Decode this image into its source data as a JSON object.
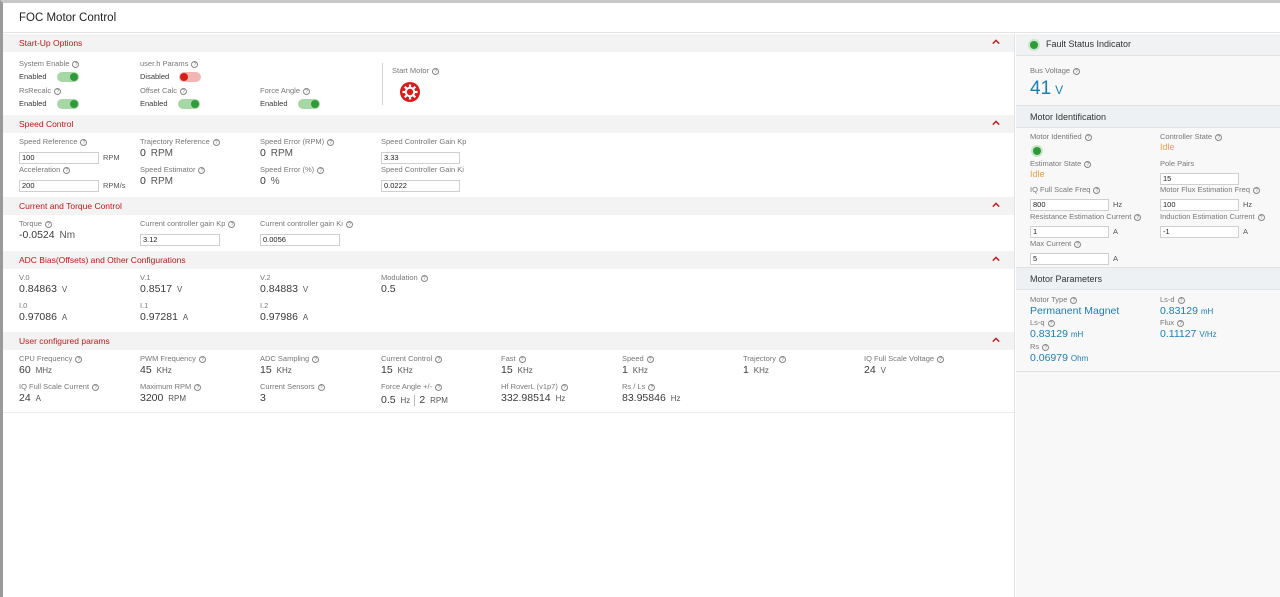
{
  "app": {
    "title": "FOC Motor Control"
  },
  "startup": {
    "title": "Start-Up Options",
    "system_enable": {
      "label": "System Enable",
      "state": "Enabled"
    },
    "userh_params": {
      "label": "user.h Params",
      "state": "Disabled"
    },
    "rsrecalc": {
      "label": "RsRecalc",
      "state": "Enabled"
    },
    "offset_calc": {
      "label": "Offset Calc",
      "state": "Enabled"
    },
    "force_angle": {
      "label": "Force Angle",
      "state": "Enabled"
    },
    "start_motor": {
      "label": "Start Motor"
    }
  },
  "speed": {
    "title": "Speed Control",
    "speed_reference": {
      "label": "Speed Reference",
      "value": "100",
      "unit": "RPM"
    },
    "trajectory_reference": {
      "label": "Trajectory Reference",
      "value": "0",
      "unit": "RPM"
    },
    "speed_error_rpm": {
      "label": "Speed Error (RPM)",
      "value": "0",
      "unit": "RPM"
    },
    "kp": {
      "label": "Speed Controller Gain Kp",
      "value": "3.33"
    },
    "acceleration": {
      "label": "Acceleration",
      "value": "200",
      "unit": "RPM/s"
    },
    "speed_estimator": {
      "label": "Speed Estimator",
      "value": "0",
      "unit": "RPM"
    },
    "speed_error_pct": {
      "label": "Speed Error (%)",
      "value": "0",
      "unit": "%"
    },
    "ki": {
      "label": "Speed Controller Gain Ki",
      "value": "0.0222"
    }
  },
  "current": {
    "title": "Current and Torque Control",
    "torque": {
      "label": "Torque",
      "value": "-0.0524",
      "unit": "Nm"
    },
    "kp": {
      "label": "Current controller gain Kp",
      "value": "3.12"
    },
    "ki": {
      "label": "Current controller gain Ki",
      "value": "0.0056"
    }
  },
  "adc": {
    "title": "ADC Bias(Offsets) and Other Configurations",
    "v0": {
      "label": "V.0",
      "value": "0.84863",
      "unit": "V"
    },
    "v1": {
      "label": "V.1",
      "value": "0.8517",
      "unit": "V"
    },
    "v2": {
      "label": "V.2",
      "value": "0.84883",
      "unit": "V"
    },
    "modulation": {
      "label": "Modulation",
      "value": "0.5"
    },
    "i0": {
      "label": "I.0",
      "value": "0.97086",
      "unit": "A"
    },
    "i1": {
      "label": "I.1",
      "value": "0.97281",
      "unit": "A"
    },
    "i2": {
      "label": "I.2",
      "value": "0.97986",
      "unit": "A"
    }
  },
  "user": {
    "title": "User configured params",
    "cpu": {
      "label": "CPU Frequency",
      "value": "60",
      "unit": "MHz"
    },
    "pwm": {
      "label": "PWM Frequency",
      "value": "45",
      "unit": "KHz"
    },
    "adc": {
      "label": "ADC Sampling",
      "value": "15",
      "unit": "KHz"
    },
    "cc": {
      "label": "Current Control",
      "value": "15",
      "unit": "KHz"
    },
    "fast": {
      "label": "Fast",
      "value": "15",
      "unit": "KHz"
    },
    "speed": {
      "label": "Speed",
      "value": "1",
      "unit": "KHz"
    },
    "traj": {
      "label": "Trajectory",
      "value": "1",
      "unit": "KHz"
    },
    "iqv": {
      "label": "IQ Full Scale Voltage",
      "value": "24",
      "unit": "V"
    },
    "iqc": {
      "label": "IQ Full Scale Current",
      "value": "24",
      "unit": "A"
    },
    "maxrpm": {
      "label": "Maximum RPM",
      "value": "3200",
      "unit": "RPM"
    },
    "sensors": {
      "label": "Current Sensors",
      "value": "3"
    },
    "forceangle": {
      "label": "Force Angle +/-",
      "value1": "0.5",
      "unit1": "Hz",
      "value2": "2",
      "unit2": "RPM"
    },
    "hf": {
      "label": "Hf RoverL (v1p7)",
      "value": "332.98514",
      "unit": "Hz"
    },
    "rsls": {
      "label": "Rs / Ls",
      "value": "83.95846",
      "unit": "Hz"
    }
  },
  "side": {
    "fault": {
      "label": "Fault Status Indicator"
    },
    "bus": {
      "label": "Bus Voltage",
      "value": "41",
      "unit": "V"
    },
    "ident": {
      "title": "Motor Identification",
      "identified": {
        "label": "Motor Identified"
      },
      "controller_state": {
        "label": "Controller State",
        "value": "Idle"
      },
      "estimator_state": {
        "label": "Estimator State",
        "value": "Idle"
      },
      "pole_pairs": {
        "label": "Pole Pairs",
        "value": "15"
      },
      "iq_freq": {
        "label": "IQ Full Scale Freq",
        "value": "800",
        "unit": "Hz"
      },
      "flux_freq": {
        "label": "Motor Flux Estimation Freq",
        "value": "100",
        "unit": "Hz"
      },
      "res_current": {
        "label": "Resistance Estimation Current",
        "value": "1",
        "unit": "A"
      },
      "ind_current": {
        "label": "Induction Estimation Current",
        "value": "-1",
        "unit": "A"
      },
      "max_current": {
        "label": "Max Current",
        "value": "5",
        "unit": "A"
      }
    },
    "params": {
      "title": "Motor Parameters",
      "motor_type": {
        "label": "Motor Type",
        "value": "Permanent Magnet"
      },
      "lsd": {
        "label": "Ls-d",
        "value": "0.83129",
        "unit": "mH"
      },
      "lsq": {
        "label": "Ls-q",
        "value": "0.83129",
        "unit": "mH"
      },
      "flux": {
        "label": "Flux",
        "value": "0.11127",
        "unit": "V/Hz"
      },
      "rs": {
        "label": "Rs",
        "value": "0.06979",
        "unit": "Ohm"
      }
    }
  },
  "colors": {
    "accent_red": "#c01818",
    "toggle_on": "#2e9a3a",
    "toggle_off": "#d81c1c",
    "value_blue": "#1a7fb3",
    "state_orange": "#f0a040"
  }
}
